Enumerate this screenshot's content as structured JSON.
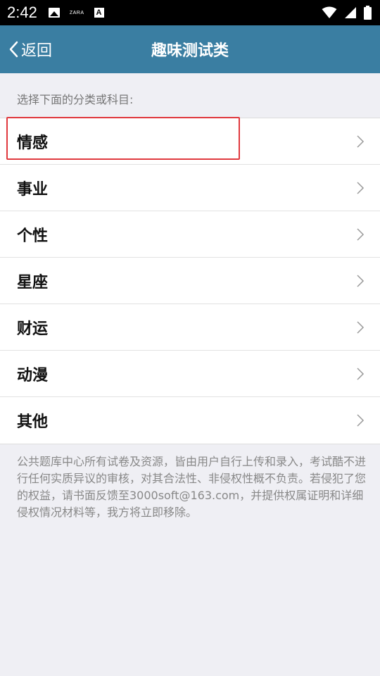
{
  "status_bar": {
    "time": "2:42",
    "notification_text": "ZARA",
    "notification_letter": "A"
  },
  "nav": {
    "back_label": "返回",
    "title": "趣味测试类"
  },
  "section_header": "选择下面的分类或科目:",
  "categories": [
    {
      "label": "情感"
    },
    {
      "label": "事业"
    },
    {
      "label": "个性"
    },
    {
      "label": "星座"
    },
    {
      "label": "财运"
    },
    {
      "label": "动漫"
    },
    {
      "label": "其他"
    }
  ],
  "footer_note": "公共题库中心所有试卷及资源，皆由用户自行上传和录入，考试酷不进行任何实质异议的审核，对其合法性、非侵权性概不负责。若侵犯了您的权益，请书面反馈至3000soft@163.com，并提供权属证明和详细侵权情况材料等，我方将立即移除。",
  "colors": {
    "nav_background": "#3a7ea2",
    "page_background": "#efeff4",
    "highlight_border": "#e0393e"
  }
}
